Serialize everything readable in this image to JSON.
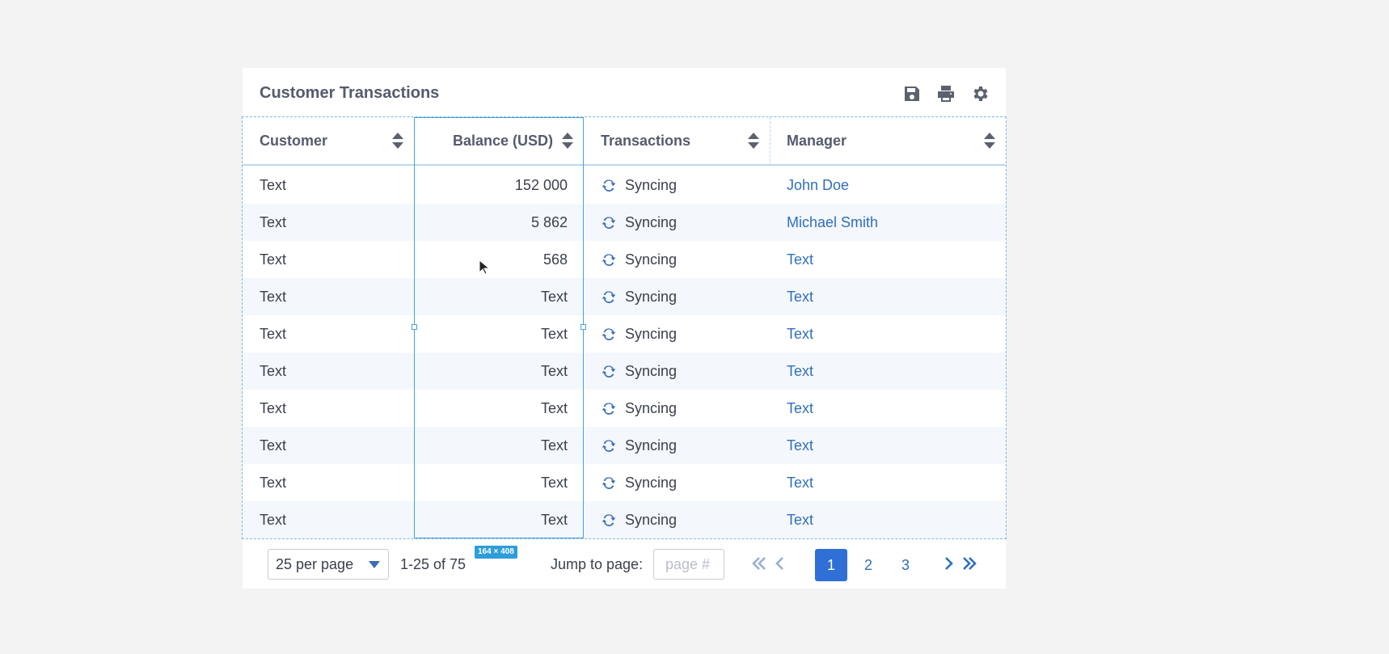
{
  "card": {
    "title": "Customer Transactions",
    "icons": [
      "save-icon",
      "print-icon",
      "gear-icon"
    ]
  },
  "columns": [
    {
      "label": "Customer"
    },
    {
      "label": "Balance (USD)"
    },
    {
      "label": "Transactions"
    },
    {
      "label": "Manager"
    }
  ],
  "rows": [
    {
      "customer": "Text",
      "balance": "152 000",
      "transactions": "Syncing",
      "manager": "John Doe"
    },
    {
      "customer": "Text",
      "balance": "5 862",
      "transactions": "Syncing",
      "manager": "Michael Smith"
    },
    {
      "customer": "Text",
      "balance": "568",
      "transactions": "Syncing",
      "manager": "Text"
    },
    {
      "customer": "Text",
      "balance": "Text",
      "transactions": "Syncing",
      "manager": "Text"
    },
    {
      "customer": "Text",
      "balance": "Text",
      "transactions": "Syncing",
      "manager": "Text"
    },
    {
      "customer": "Text",
      "balance": "Text",
      "transactions": "Syncing",
      "manager": "Text"
    },
    {
      "customer": "Text",
      "balance": "Text",
      "transactions": "Syncing",
      "manager": "Text"
    },
    {
      "customer": "Text",
      "balance": "Text",
      "transactions": "Syncing",
      "manager": "Text"
    },
    {
      "customer": "Text",
      "balance": "Text",
      "transactions": "Syncing",
      "manager": "Text"
    },
    {
      "customer": "Text",
      "balance": "Text",
      "transactions": "Syncing",
      "manager": "Text"
    }
  ],
  "selection": {
    "dimensions": "164 × 408"
  },
  "footer": {
    "per_page": "25 per page",
    "range": "1-25 of 75",
    "jump_label": "Jump to page:",
    "jump_placeholder": "page #",
    "pages": [
      "1",
      "2",
      "3"
    ],
    "active_page": "1"
  },
  "colors": {
    "accent": "#2f6fd6",
    "link": "#2f6fbd",
    "selection": "#4aa0db"
  }
}
